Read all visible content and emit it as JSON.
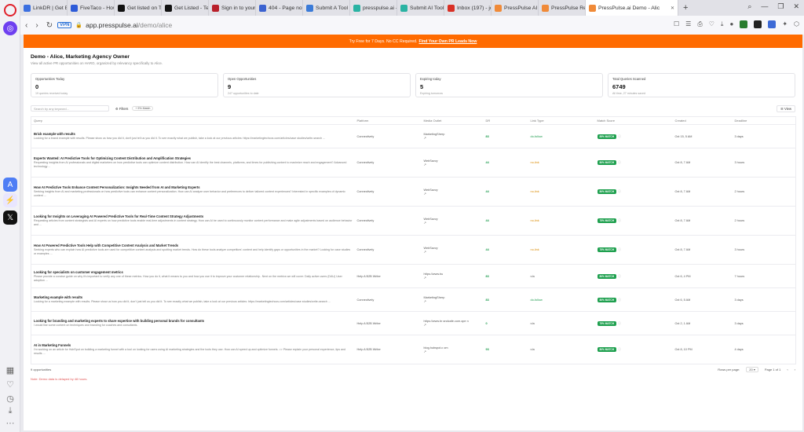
{
  "tabs": [
    {
      "label": "LinkDR | Get Bac",
      "color": "#3b6fe0"
    },
    {
      "label": "FiveTaco - How S",
      "color": "#2d5bd8"
    },
    {
      "label": "Get listed on Tin",
      "color": "#111111"
    },
    {
      "label": "Get Listed - Teky",
      "color": "#111111"
    },
    {
      "label": "Sign in to your a",
      "color": "#b9202b"
    },
    {
      "label": "404 - Page not fo",
      "color": "#3b62d0"
    },
    {
      "label": "Submit A Tool To",
      "color": "#3b7bd8"
    },
    {
      "label": "presspulse.ai - R",
      "color": "#2ab3a3"
    },
    {
      "label": "Submit AI Tool to",
      "color": "#2ab3a3"
    },
    {
      "label": "Inbox (197) - jon",
      "color": "#d93025"
    },
    {
      "label": "PressPulse AI | R",
      "color": "#f08a38"
    },
    {
      "label": "PressPulse Revie",
      "color": "#f08a38"
    },
    {
      "label": "PressPulse.ai Demo - Alic",
      "color": "#f08a38",
      "active": true
    }
  ],
  "address": {
    "vpn": "VPN",
    "domain": "app.presspulse.ai",
    "path": "/demo/alice"
  },
  "banner": {
    "text": "Try Free for 7 Days. No CC Required.",
    "link": "Find Your Own PR Leads Now"
  },
  "page": {
    "title": "Demo - Alice, Marketing Agency Owner",
    "subtitle": "View all active PR opportunities on HARO, organized by relevancy specifically to Alice."
  },
  "stats": [
    {
      "label": "Opportunities Today",
      "value": "0",
      "note": "19 queries received today"
    },
    {
      "label": "Open Opportunities",
      "value": "9",
      "note": "247 opportunities to date"
    },
    {
      "label": "Expiring today",
      "value": "5",
      "note": "Expiring tomorrow"
    },
    {
      "label": "Total Queries Scanned",
      "value": "6749",
      "note": "All time, 27 minutes saved"
    }
  ],
  "toolbar": {
    "search_placeholder": "Search by any keyword...",
    "filters": "Filters",
    "chip": "+ 9% Match",
    "view": "View"
  },
  "columns": [
    "Query",
    "Platform",
    "Media Outlet",
    "DR",
    "Link Type",
    "Match Score",
    "Created",
    "Deadline"
  ],
  "rows": [
    {
      "title": "Brick example with results",
      "body": "Looking for a brand example with results. Please show us how you did it, don't just tell us you did it. To see exactly what we publish, take a look at our previous articles: https://marketingtechcos.com/articles/case studies/write-search ...",
      "platform": "Connectively",
      "outlet": "MarketingSherp",
      "dr": "83",
      "link": "do-follow",
      "match": "85% MATCH",
      "created": "Oct 15, 5 AM",
      "deadline": "3 days"
    },
    {
      "title": "Experts Wanted: AI Predictive Tools for Optimizing Content Distribution and Amplification Strategies",
      "body": "Requesting insights from AI professionals and digital marketers on how predictive tools can optimize content distribution. How can AI identify the best channels, platforms, and times for publishing content to maximize reach and engagement? Advanced technology ...",
      "platform": "Connectively",
      "outlet": "WebSavvy",
      "dr": "44",
      "link": "no-link",
      "match": "80% MATCH",
      "created": "Oct 8, 7 AM",
      "deadline": "3 hours"
    },
    {
      "title": "How AI Predictive Tools Enhance Content Personalization: Insights Needed from AI and Marketing Experts",
      "body": "Seeking insights from AI and marketing professionals on how predictive tools can enhance content personalization. How can AI analyze user behavior and preferences to deliver tailored content experiences? Interested in specific examples of dynamic content ...",
      "platform": "Connectively",
      "outlet": "WebSavvy",
      "dr": "44",
      "link": "no-link",
      "match": "80% MATCH",
      "created": "Oct 8, 7 AM",
      "deadline": "2 hours"
    },
    {
      "title": "Looking for Insights on Leveraging AI Powered Predictive Tools for Real-Time Content Strategy Adjustments",
      "body": "Requesting articles from content strategists and AI experts on how predictive tools enable real-time adjustments in content strategy. How can AI be used to continuously monitor content performance and make agile adjustments based on audience behavior and ...",
      "platform": "Connectively",
      "outlet": "WebSavvy",
      "dr": "44",
      "link": "no-link",
      "match": "75% MATCH",
      "created": "Oct 8, 7 AM",
      "deadline": "2 hours"
    },
    {
      "title": "How AI Powered Predictive Tools Help with Competitive Content Analysis and Market Trends",
      "body": "Seeking experts who can explain how AI predictive tools are used for competitive content analysis and spotting market trends. How do these tools analyze competitors' content and help identify gaps or opportunities in the market? Looking for case studies or examples ...",
      "platform": "Connectively",
      "outlet": "WebSavvy",
      "dr": "44",
      "link": "no-link",
      "match": "75% MATCH",
      "created": "Oct 8, 7 AM",
      "deadline": "3 hours"
    },
    {
      "title": "Looking for specialists on customer engagement metrics",
      "body": "Please provide a concise guide on why it's important to verify any one of these metrics. How you do it, what it means to you and how you use it to improve your customer relationship.. Next on the metrics we will cover: Daily active users (DAU) User adoption ...",
      "platform": "Help A B2B Writer",
      "outlet": "https://www.bu",
      "dr": "83",
      "link": "n/a",
      "match": "80% MATCH",
      "created": "Oct 6, 4 PM",
      "deadline": "7 hours"
    },
    {
      "title": "Marketing example with results",
      "body": "Looking for a marketing example with results. Please show us how you did it, don't just tell us you did it. To see exactly what we publish, take a look at our previous articles: https://marketingtechcos.com/articles/case studies/write-search ...",
      "platform": "Connectively",
      "outlet": "MarketingSherp",
      "dr": "83",
      "link": "do-follow",
      "match": "80% MATCH",
      "created": "Oct 6, 5 AM",
      "deadline": "3 days"
    },
    {
      "title": "Looking for branding and marketing experts to share expertise with building personal brands for consultants",
      "body": "I would like some content on techniques and branding for coaches and consultants.",
      "platform": "Help A B2B Writer",
      "outlet": "https://www.br andcafe.com.ope n",
      "dr": "0",
      "link": "n/a",
      "match": "75% MATCH",
      "created": "Oct 2, 1 AM",
      "deadline": "3 days"
    },
    {
      "title": "AI in Marketing Funnels",
      "body": "I'm working on an article for HubSpot on building a marketing funnel with a tool on looking for users using AI marketing strategies and the tools they use. How can AI speed up and optimize funnels. => Please explain your personal experience, tips and results ...",
      "platform": "Help A B2B Writer",
      "outlet": "blog.hubspot.c om",
      "dr": "93",
      "link": "n/a",
      "match": "80% MATCH",
      "created": "Oct 8, 10 PM",
      "deadline": "4 days"
    }
  ],
  "footer": {
    "count": "9 opportunities",
    "rows_label": "Rows per page:",
    "rows_value": "20",
    "page": "Page 1 of 1",
    "note": "Note: Demo data is delayed by 48 hours."
  },
  "colors": {
    "accent": "#ff6b00",
    "match": "#1fa04f",
    "dr": "#1a9a4b"
  }
}
